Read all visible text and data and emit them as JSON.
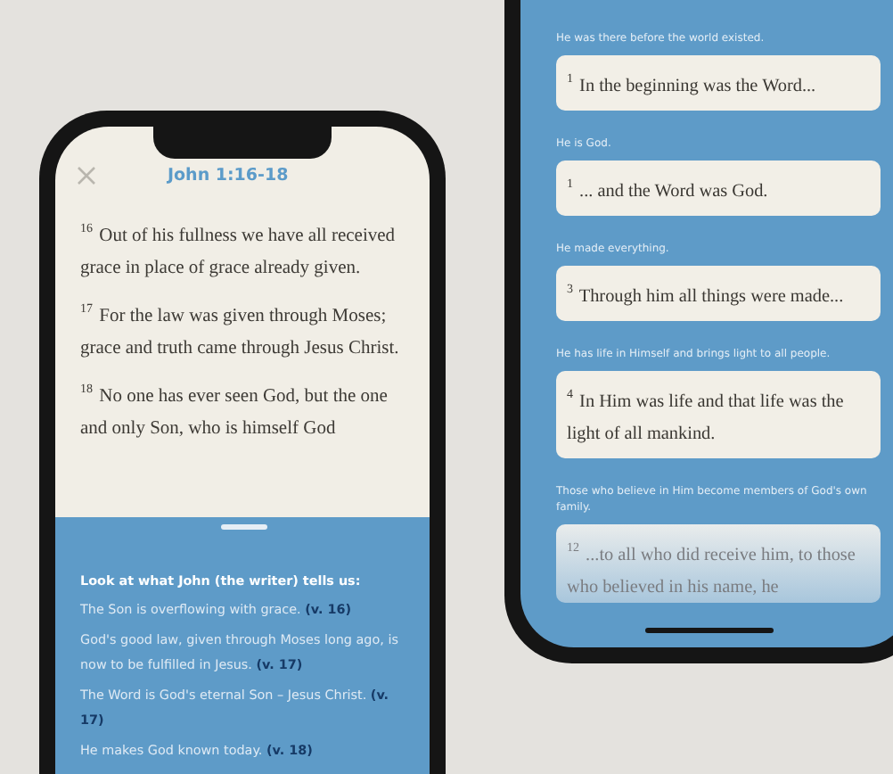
{
  "left_phone": {
    "title": "John 1:16-18",
    "verses": [
      {
        "number": "16",
        "text": "Out of his fullness we have all received grace in place of grace already given."
      },
      {
        "number": "17",
        "text": "For the law was given through Moses; grace and truth came through Jesus Christ."
      },
      {
        "number": "18",
        "text": "No one has ever seen God, but the one and only Son, who is himself God"
      }
    ],
    "sheet": {
      "heading": "Look at what John (the writer) tells us:",
      "items": [
        {
          "text": "The Son is overflowing with grace.",
          "ref": "(v. 16)"
        },
        {
          "text": "God's good law, given through Moses long ago, is now to be fulfilled in Jesus.",
          "ref": "(v. 17)"
        },
        {
          "text": "The Word is God's eternal Son – Jesus Christ.",
          "ref": "(v. 17)"
        },
        {
          "text": "He makes God known today.",
          "ref": "(v. 18)"
        }
      ]
    }
  },
  "right_phone": {
    "sections": [
      {
        "kind": "card",
        "caption": "He was there before the world existed.",
        "number": "1",
        "text": "In the beginning was the Word..."
      },
      {
        "kind": "card",
        "caption": "He is God.",
        "number": "1",
        "text": "... and the Word was God."
      },
      {
        "kind": "card",
        "caption": "He made everything.",
        "number": "3",
        "text": "Through him all things were made..."
      },
      {
        "kind": "card",
        "caption": "He has life in Himself and brings light to all people.",
        "number": "4",
        "text": "In Him was life and that life was the light of all mankind."
      },
      {
        "kind": "carousel",
        "caption": "Those who believe in Him become members of God's own family.",
        "number": "12",
        "text": "...to all who did receive him, to those who believed in his name, he"
      }
    ]
  }
}
